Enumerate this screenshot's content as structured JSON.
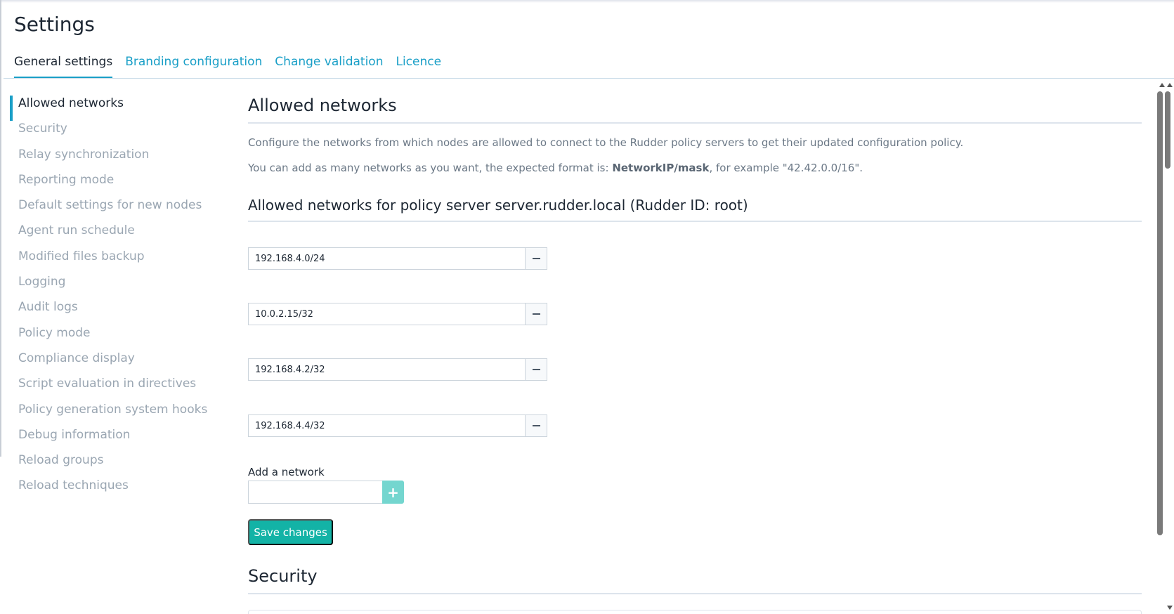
{
  "page": {
    "title": "Settings"
  },
  "tabs": [
    {
      "label": "General settings",
      "active": true
    },
    {
      "label": "Branding configuration",
      "active": false
    },
    {
      "label": "Change validation",
      "active": false
    },
    {
      "label": "Licence",
      "active": false
    }
  ],
  "sidebar": {
    "items": [
      {
        "label": "Allowed networks",
        "active": true
      },
      {
        "label": "Security"
      },
      {
        "label": "Relay synchronization"
      },
      {
        "label": "Reporting mode"
      },
      {
        "label": "Default settings for new nodes"
      },
      {
        "label": "Agent run schedule"
      },
      {
        "label": "Modified files backup"
      },
      {
        "label": "Logging"
      },
      {
        "label": "Audit logs"
      },
      {
        "label": "Policy mode"
      },
      {
        "label": "Compliance display"
      },
      {
        "label": "Script evaluation in directives"
      },
      {
        "label": "Policy generation system hooks"
      },
      {
        "label": "Debug information"
      },
      {
        "label": "Reload groups"
      },
      {
        "label": "Reload techniques"
      }
    ]
  },
  "allowed_networks": {
    "title": "Allowed networks",
    "description": "Configure the networks from which nodes are allowed to connect to the Rudder policy servers to get their updated configuration policy.",
    "format_prefix": "You can add as many networks as you want, the expected format is: ",
    "format_bold": "NetworkIP/mask",
    "format_suffix": ", for example \"42.42.0.0/16\".",
    "server_title": "Allowed networks for policy server server.rudder.local (Rudder ID: root)",
    "networks": [
      "192.168.4.0/24",
      "10.0.2.15/32",
      "192.168.4.2/32",
      "192.168.4.4/32"
    ],
    "add_label": "Add a network",
    "add_value": "",
    "add_icon": "plus-icon",
    "remove_icon": "minus-icon",
    "save_label": "Save changes"
  },
  "security": {
    "title": "Security"
  },
  "colors": {
    "accent": "#1a9fc7",
    "save": "#13b3a6",
    "add": "#74d6cf"
  }
}
